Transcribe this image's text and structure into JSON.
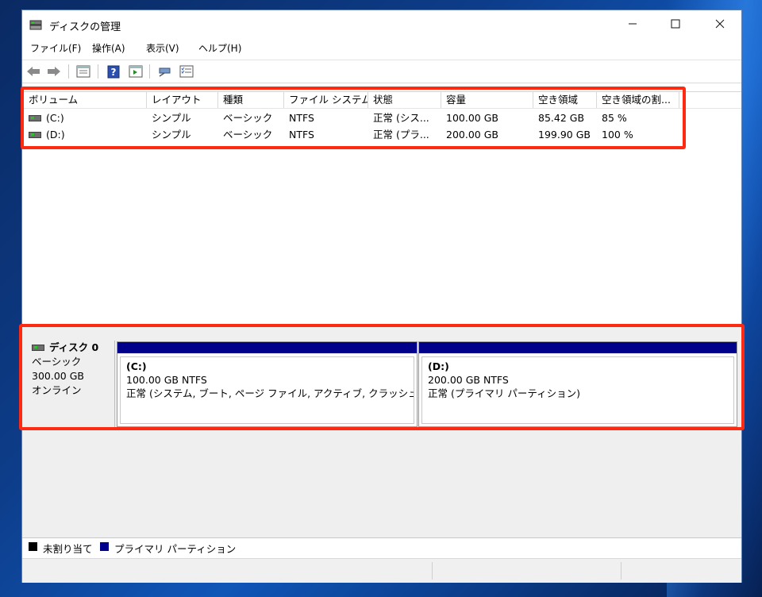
{
  "window": {
    "title": "ディスクの管理"
  },
  "menu": [
    "ファイル(F)",
    "操作(A)",
    "表示(V)",
    "ヘルプ(H)"
  ],
  "toolbar": [
    "back-icon",
    "forward-icon",
    "disk-list-icon",
    "help-icon",
    "properties-icon",
    "connect-icon",
    "checklist-icon"
  ],
  "volume_table": {
    "headers": [
      "ボリューム",
      "レイアウト",
      "種類",
      "ファイル システム",
      "状態",
      "容量",
      "空き領域",
      "空き領域の割..."
    ],
    "rows": [
      [
        "(C:)",
        "シンプル",
        "ベーシック",
        "NTFS",
        "正常 (シス...",
        "100.00 GB",
        "85.42 GB",
        "85 %"
      ],
      [
        "(D:)",
        "シンプル",
        "ベーシック",
        "NTFS",
        "正常 (プラ...",
        "200.00 GB",
        "199.90 GB",
        "100 %"
      ]
    ]
  },
  "disk": {
    "name": "ディスク 0",
    "type": "ベーシック",
    "size": "300.00 GB",
    "status": "オンライン",
    "partitions": [
      {
        "name": "(C:)",
        "size": "100.00 GB NTFS",
        "status": "正常 (システム, ブート, ページ ファイル, アクティブ, クラッシュ ダンプ,",
        "bar_color": "#00008b"
      },
      {
        "name": "(D:)",
        "size": "200.00 GB NTFS",
        "status": "正常 (プライマリ パーティション)",
        "bar_color": "#00008b"
      }
    ]
  },
  "legend": [
    {
      "label": "未割り当て",
      "color": "#000000"
    },
    {
      "label": "プライマリ パーティション",
      "color": "#00008b"
    }
  ],
  "highlight_color": "#ff2a12"
}
